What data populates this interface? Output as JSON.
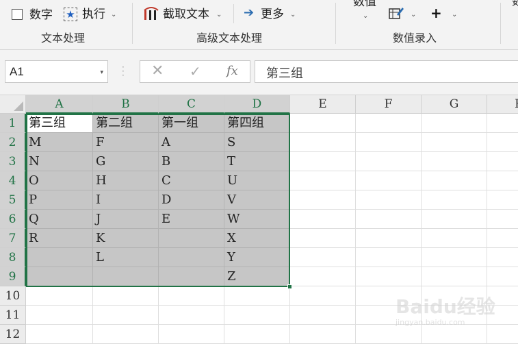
{
  "ribbon": {
    "text_group": {
      "checkbox_label": "数字",
      "execute_label": "执行",
      "group_label": "文本处理"
    },
    "advanced_group": {
      "extract_label": "截取文本",
      "more_label": "更多",
      "group_label": "高级文本处理"
    },
    "entry_group": {
      "value_label": "数值",
      "group_label": "数值录入"
    },
    "cut_off_label": "数"
  },
  "formula_bar": {
    "name_box": "A1",
    "cancel_icon": "✕",
    "enter_icon": "✓",
    "fx_label": "fx",
    "formula": "第三组"
  },
  "sheet": {
    "columns": [
      "A",
      "B",
      "C",
      "D",
      "E",
      "F",
      "G",
      "H"
    ],
    "rows": [
      "1",
      "2",
      "3",
      "4",
      "5",
      "6",
      "7",
      "8",
      "9",
      "10",
      "11",
      "12"
    ],
    "cells": [
      [
        "第三组",
        "第二组",
        "第一组",
        "第四组"
      ],
      [
        "M",
        "F",
        "A",
        "S"
      ],
      [
        "N",
        "G",
        "B",
        "T"
      ],
      [
        "O",
        "H",
        "C",
        "U"
      ],
      [
        "P",
        "I",
        "D",
        "V"
      ],
      [
        "Q",
        "J",
        "E",
        "W"
      ],
      [
        "R",
        "K",
        "",
        "X"
      ],
      [
        "",
        "L",
        "",
        "Y"
      ],
      [
        "",
        "",
        "",
        "Z"
      ]
    ],
    "active_cell": "A1",
    "selection": "A1:D9",
    "colors": {
      "accent": "#217346",
      "selection_fill": "#c6c6c6"
    }
  },
  "watermark": {
    "main": "Baidu经验",
    "sub": "jingyan.baidu.com"
  }
}
